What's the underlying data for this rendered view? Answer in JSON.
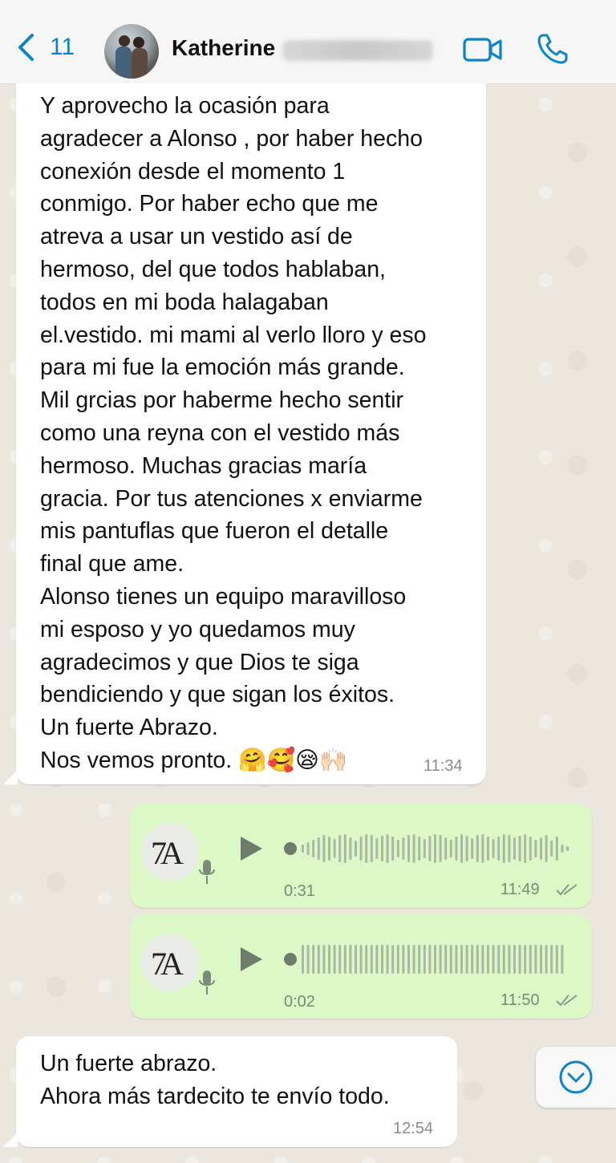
{
  "header": {
    "back_count": "11",
    "contact_name": "Katherine",
    "icons": {
      "back": "chevron-left-icon",
      "video": "video-camera-icon",
      "call": "phone-icon"
    },
    "accent_color": "#0a84c6"
  },
  "messages": [
    {
      "type": "incoming-text",
      "text": "Y aprovecho la ocasión para\nagradecer a Alonso , por haber hecho\nconexión desde el momento 1\nconmigo.  Por haber echo que me\natreva a usar un vestido así de\nhermoso, del que todos hablaban,\ntodos en mi boda halagaban\nel.vestido. mi mami al verlo lloro y eso\npara mi fue la emoción más grande.\nMil grcias por haberme hecho sentir\ncomo una reyna con el vestido más\nhermoso. Muchas gracias maría\ngracia. Por tus atenciones x enviarme\nmis pantuflas que fueron el detalle\nfinal que ame.\nAlonso tienes un equipo maravilloso\nmi esposo y yo quedamos muy\nagradecimos y que Dios te siga\nbendiciendo y que sigan los éxitos.\nUn fuerte Abrazo.\nNos vemos pronto. 🤗🥰😪🙌🏻",
      "time": "11:34"
    },
    {
      "type": "outgoing-voice",
      "duration": "0:31",
      "time": "11:49",
      "avatar_mark": "7A"
    },
    {
      "type": "outgoing-voice",
      "duration": "0:02",
      "time": "11:50",
      "avatar_mark": "7A"
    },
    {
      "type": "incoming-text",
      "text": "Un fuerte abrazo.\nAhora más tardecito te envío todo.",
      "time": "12:54"
    }
  ],
  "colors": {
    "incoming_bubble": "#ffffff",
    "outgoing_bubble": "#dcf8c6",
    "chat_background": "#ece7df"
  }
}
